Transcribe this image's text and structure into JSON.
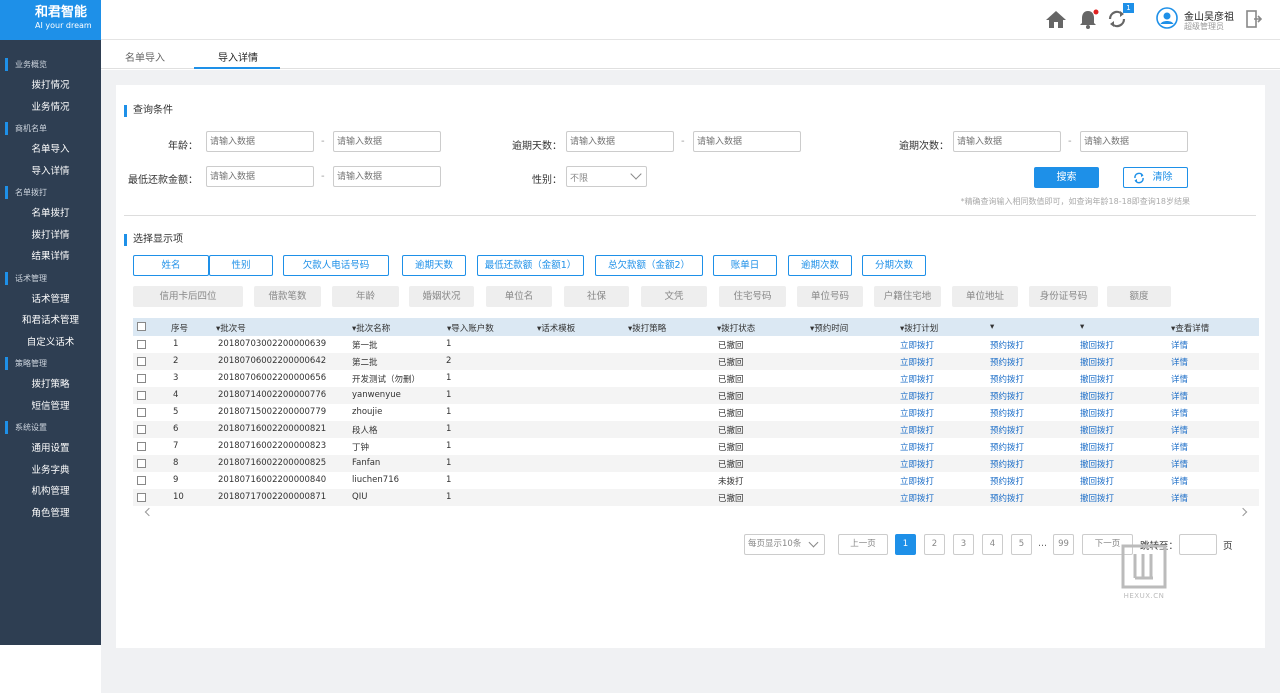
{
  "sidebar": {
    "brand": "和君智能",
    "slogan": "AI  your dream",
    "groups": [
      {
        "title": "业务概览",
        "items": [
          "拨打情况",
          "业务情况"
        ]
      },
      {
        "title": "商机名单",
        "items": [
          "名单导入",
          "导入详情"
        ]
      },
      {
        "title": "名单拨打",
        "items": [
          "名单拨打",
          "拨打详情",
          "结果详情"
        ]
      },
      {
        "title": "话术管理",
        "items": [
          "话术管理",
          "和君话术管理",
          "自定义话术"
        ]
      },
      {
        "title": "策略管理",
        "items": [
          "拨打策略",
          "短信管理"
        ]
      },
      {
        "title": "系统设置",
        "items": [
          "通用设置",
          "业务字典",
          "机构管理",
          "角色管理"
        ]
      }
    ]
  },
  "header": {
    "badge": "1",
    "user_name": "金山吴彦祖",
    "user_role": "超级管理员",
    "icons": [
      "home-icon",
      "bell-icon",
      "sync-icon",
      "user-icon",
      "logout-icon"
    ],
    "accent": "#1e90e8",
    "dot_color": "#e02020"
  },
  "tabs": [
    {
      "label": "名单导入",
      "active": false
    },
    {
      "label": "导入详情",
      "active": true
    }
  ],
  "query": {
    "section_title": "查询条件",
    "placeholder": "请输入数据",
    "age_label": "年龄：",
    "overdue_days_label": "逾期天数：",
    "overdue_times_label": "逾期次数：",
    "min_repay_label": "最低还款金额：",
    "gender_label": "性别：",
    "gender_value": "不限",
    "search_label": "搜索",
    "clear_label": "清除",
    "hint": "*精确查询输入相同数值即可，如查询年龄18-18即查询18岁结果"
  },
  "display": {
    "section_title": "选择显示项",
    "selected": [
      "姓名",
      "性别",
      "欠款人电话号码",
      "逾期天数",
      "最低还款额（金额1）",
      "总欠款额（金额2）",
      "账单日",
      "逾期次数",
      "分期次数"
    ],
    "unselected": [
      "信用卡后四位",
      "借款笔数",
      "年龄",
      "婚姻状况",
      "单位名",
      "社保",
      "文凭",
      "住宅号码",
      "单位号码",
      "户籍住宅地",
      "单位地址",
      "身份证号码",
      "额度"
    ]
  },
  "table": {
    "headers": [
      "序号",
      "▾批次号",
      "▾批次名称",
      "▾导入账户数",
      "▾话术模板",
      "▾拨打策略",
      "▾拨打状态",
      "▾预约时间",
      "▾拨打计划",
      "▾",
      "▾",
      "▾查看详情"
    ],
    "rows": [
      {
        "no": "1",
        "batch": "20180703002200000639",
        "name": "第一批",
        "count": "1",
        "status": "已撤回"
      },
      {
        "no": "2",
        "batch": "20180706002200000642",
        "name": "第二批",
        "count": "2",
        "status": "已撤回"
      },
      {
        "no": "3",
        "batch": "20180706002200000656",
        "name": "开发测试（勿删）",
        "count": "1",
        "status": "已撤回"
      },
      {
        "no": "4",
        "batch": "20180714002200000776",
        "name": "yanwenyue",
        "count": "1",
        "status": "已撤回"
      },
      {
        "no": "5",
        "batch": "20180715002200000779",
        "name": "zhoujie",
        "count": "1",
        "status": "已撤回"
      },
      {
        "no": "6",
        "batch": "20180716002200000821",
        "name": "段人格",
        "count": "1",
        "status": "已撤回"
      },
      {
        "no": "7",
        "batch": "20180716002200000823",
        "name": "丁钟",
        "count": "1",
        "status": "已撤回"
      },
      {
        "no": "8",
        "batch": "20180716002200000825",
        "name": "Fanfan",
        "count": "1",
        "status": "已撤回"
      },
      {
        "no": "9",
        "batch": "20180716002200000840",
        "name": "liuchen716",
        "count": "1",
        "status": "未拨打"
      },
      {
        "no": "10",
        "batch": "20180717002200000871",
        "name": "QIU",
        "count": "1",
        "status": "已撤回"
      }
    ],
    "actions": {
      "dial_now": "立即拨打",
      "schedule": "预约拨打",
      "revoke": "撤回拨打",
      "detail": "详情"
    }
  },
  "pagination": {
    "page_size": "每页显示10条",
    "prev": "上一页",
    "pages": [
      "1",
      "2",
      "3",
      "4",
      "5"
    ],
    "ellipsis": "...",
    "last": "99",
    "next": "下一页",
    "jump_label": "跳转至：",
    "page_unit": "页",
    "current": 1
  },
  "watermark": "HEXUX.CN"
}
